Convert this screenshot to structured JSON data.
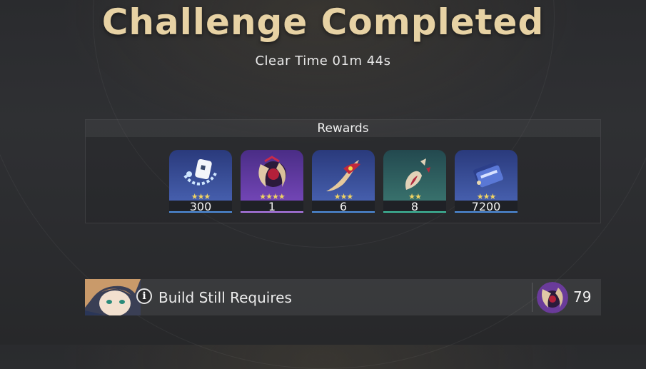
{
  "header": {
    "title": "Challenge Completed",
    "clear_time": "Clear Time 01m 44s"
  },
  "rewards": {
    "label": "Rewards",
    "items": [
      {
        "icon": "exp-material-icon",
        "rarity": 3,
        "stars": "★★★",
        "count": "300",
        "accent": "#4f8fe0"
      },
      {
        "icon": "claw-core-icon",
        "rarity": 4,
        "stars": "★★★★",
        "count": "1",
        "accent": "#b57cf0"
      },
      {
        "icon": "talon-fragment-icon",
        "rarity": 3,
        "stars": "★★★",
        "count": "6",
        "accent": "#4f8fe0"
      },
      {
        "icon": "broken-horn-icon",
        "rarity": 2,
        "stars": "★★",
        "count": "8",
        "accent": "#3fbf9f"
      },
      {
        "icon": "credit-card-icon",
        "rarity": 3,
        "stars": "★★★",
        "count": "7200",
        "accent": "#4f8fe0"
      }
    ]
  },
  "build": {
    "label": "Build Still Requires",
    "material_icon": "claw-material-icon",
    "material_count": "79"
  },
  "colors": {
    "title": "#e7d2a4",
    "rarity_3": "#4f8fe0",
    "rarity_4": "#b57cf0",
    "rarity_2": "#3fbf9f",
    "star": "#f1d463"
  }
}
